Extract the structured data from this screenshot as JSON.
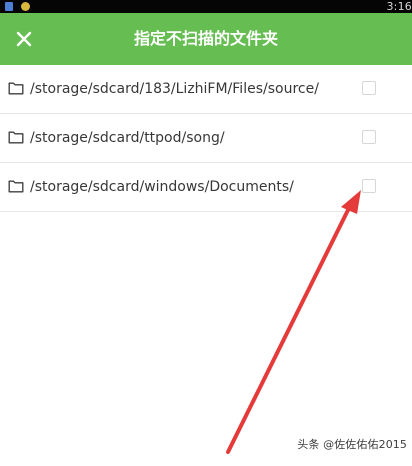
{
  "status_bar": {
    "time": "3:16"
  },
  "header": {
    "title": "指定不扫描的文件夹",
    "close_icon": "close-icon",
    "background_color": "#66bd52"
  },
  "folders": [
    {
      "path": "/storage/sdcard/183/LizhiFM/Files/source/",
      "icon": "folder-icon",
      "checked": false
    },
    {
      "path": "/storage/sdcard/ttpod/song/",
      "icon": "folder-icon",
      "checked": false
    },
    {
      "path": "/storage/sdcard/windows/Documents/",
      "icon": "folder-icon",
      "checked": false
    }
  ],
  "annotation": {
    "arrow_color": "#e53a3a",
    "icon": "red-arrow-icon"
  },
  "watermark": {
    "text": "头条 @佐佐佑佑2015"
  }
}
